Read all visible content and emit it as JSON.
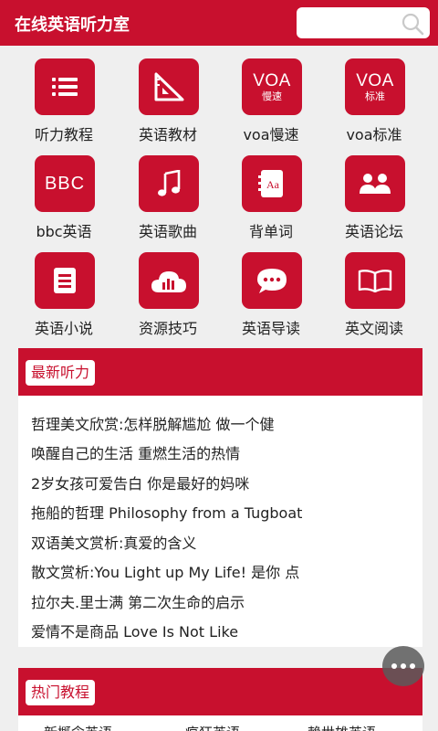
{
  "header": {
    "title": "在线英语听力室",
    "search": {
      "placeholder": "",
      "icon": "search-icon"
    }
  },
  "grid": {
    "items": [
      {
        "label": "听力教程",
        "icon": "list-icon"
      },
      {
        "label": "英语教材",
        "icon": "ruler-icon"
      },
      {
        "label": "voa慢速",
        "icon": "voa-icon",
        "badge_main": "VOA",
        "badge_sub": "慢速"
      },
      {
        "label": "voa标准",
        "icon": "voa-icon",
        "badge_main": "VOA",
        "badge_sub": "标准"
      },
      {
        "label": "bbc英语",
        "icon": "bbc-icon",
        "badge_main": "BBC"
      },
      {
        "label": "英语歌曲",
        "icon": "music-note-icon"
      },
      {
        "label": "背单词",
        "icon": "dictionary-icon"
      },
      {
        "label": "英语论坛",
        "icon": "users-icon"
      },
      {
        "label": "英语小说",
        "icon": "document-icon"
      },
      {
        "label": "资源技巧",
        "icon": "cloud-chart-icon"
      },
      {
        "label": "英语导读",
        "icon": "chat-bubble-icon"
      },
      {
        "label": "英文阅读",
        "icon": "open-book-icon"
      }
    ]
  },
  "latest": {
    "title": "最新听力",
    "items": [
      "哲理美文欣赏:怎样脱解尴尬 做一个健",
      "唤醒自己的生活 重燃生活的热情",
      "2岁女孩可爱告白 你是最好的妈咪",
      "拖船的哲理 Philosophy from a Tugboat",
      "双语美文赏析:真爱的含义",
      "散文赏析:You Light up My Life! 是你 点",
      "拉尔夫.里士满 第二次生命的启示",
      "爱情不是商品 Love Is Not Like"
    ]
  },
  "popular": {
    "title": "热门教程",
    "items": [
      "新概念英语",
      "疯狂英语",
      "赖世雄英语"
    ]
  },
  "colors": {
    "brand": "#c8102e",
    "background": "#efefef"
  }
}
